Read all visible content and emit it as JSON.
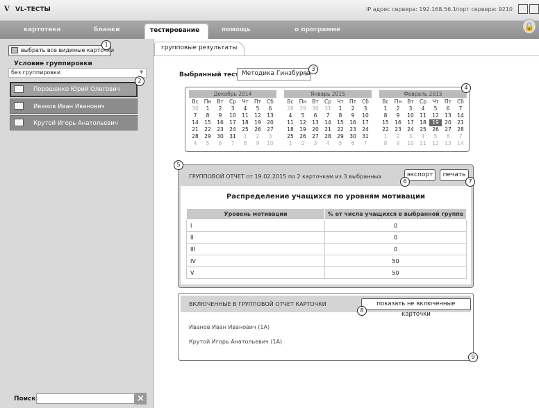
{
  "app": {
    "logo": "V",
    "title": "VL-ТЕСТЫ",
    "server_ip": "IP адрес сервера: 192.168.56.1",
    "server_port": "порт сервера: 9210"
  },
  "menu": {
    "items": [
      "картотека",
      "бланки",
      "тестирование",
      "помощь",
      "о программе"
    ]
  },
  "sidebar": {
    "select_visible_label": "выбрать все видимые карточки",
    "group_condition_title": "Условие группировки",
    "group_select_value": "без группировки",
    "cards": [
      "Порошенко Юрий Олегович",
      "Иванов Иван Иванович",
      "Крутой Игорь Анатольевич"
    ],
    "search_label": "Поиск:",
    "search_value": ""
  },
  "main": {
    "tab_label": "групповые результаты",
    "selected_test_label": "Выбранный тест",
    "selected_test_value": "Методика Гинзбурга",
    "calendars": [
      {
        "month": "Декабрь 2014",
        "weekdays": [
          "Вс",
          "Пн",
          "Вт",
          "Ср",
          "Чт",
          "Пт",
          "Сб"
        ],
        "days": [
          "30",
          "1",
          "2",
          "3",
          "4",
          "5",
          "6",
          "7",
          "8",
          "9",
          "10",
          "11",
          "12",
          "13",
          "14",
          "15",
          "16",
          "17",
          "18",
          "19",
          "20",
          "21",
          "22",
          "23",
          "24",
          "25",
          "26",
          "27",
          "28",
          "29",
          "30",
          "31",
          "1",
          "2",
          "3",
          "4",
          "5",
          "6",
          "7",
          "8",
          "9",
          "10"
        ],
        "other_month": [
          0,
          32,
          33,
          34,
          35,
          36,
          37,
          38,
          39,
          40,
          41
        ],
        "today": -1
      },
      {
        "month": "Январь 2015",
        "weekdays": [
          "Вс",
          "Пн",
          "Вт",
          "Ср",
          "Чт",
          "Пт",
          "Сб"
        ],
        "days": [
          "28",
          "29",
          "30",
          "31",
          "1",
          "2",
          "3",
          "4",
          "5",
          "6",
          "7",
          "8",
          "9",
          "10",
          "11",
          "12",
          "13",
          "14",
          "15",
          "16",
          "17",
          "18",
          "19",
          "20",
          "21",
          "22",
          "23",
          "24",
          "25",
          "26",
          "27",
          "28",
          "29",
          "30",
          "31",
          "1",
          "2",
          "3",
          "4",
          "5",
          "6",
          "7"
        ],
        "other_month": [
          0,
          1,
          2,
          3,
          35,
          36,
          37,
          38,
          39,
          40,
          41
        ],
        "today": -1
      },
      {
        "month": "Февраль 2015",
        "weekdays": [
          "Вс",
          "Пн",
          "Вт",
          "Ср",
          "Чт",
          "Пт",
          "Сб"
        ],
        "days": [
          "1",
          "2",
          "3",
          "4",
          "5",
          "6",
          "7",
          "8",
          "9",
          "10",
          "11",
          "12",
          "13",
          "14",
          "15",
          "16",
          "17",
          "18",
          "19",
          "20",
          "21",
          "22",
          "23",
          "24",
          "25",
          "26",
          "27",
          "28",
          "1",
          "2",
          "3",
          "4",
          "5",
          "6",
          "7",
          "8",
          "9",
          "10",
          "11",
          "12",
          "13",
          "14"
        ],
        "other_month": [
          28,
          29,
          30,
          31,
          32,
          33,
          34,
          35,
          36,
          37,
          38,
          39,
          40,
          41
        ],
        "today": 18
      }
    ],
    "report": {
      "title": "ГРУППОВОЙ ОТЧЕТ от 19.02.2015 по 2 карточкам из 3 выбранных",
      "export_label": "экспорт",
      "print_label": "печать",
      "distribution_title": "Распределение учащихся по уровням мотивации",
      "columns": [
        "Уровень мотивации",
        "% от числа учащихся в выбранной группе"
      ],
      "rows": [
        {
          "level": "I",
          "percent": "0"
        },
        {
          "level": "II",
          "percent": "0"
        },
        {
          "level": "III",
          "percent": "0"
        },
        {
          "level": "IV",
          "percent": "50"
        },
        {
          "level": "V",
          "percent": "50"
        }
      ]
    },
    "included": {
      "title": "ВКЛЮЧЕННЫЕ В ГРУППОВОЙ ОТЧЕТ КАРТОЧКИ",
      "show_excluded_label": "показать не включенные карточки",
      "items": [
        "Иванов Иван Иванович (1А)",
        "Крутой Игорь Анатольевич (1А)"
      ]
    }
  },
  "callouts": [
    "1",
    "2",
    "3",
    "4",
    "5",
    "6",
    "7",
    "8",
    "9"
  ]
}
